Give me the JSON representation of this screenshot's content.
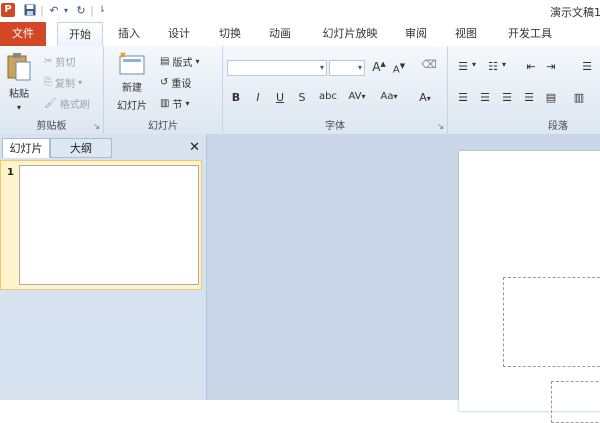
{
  "window": {
    "app_icon": "P",
    "title": "演示文稿1"
  },
  "quick_access": {
    "save_icon": "save-icon",
    "undo_icon": "undo-icon",
    "redo_icon": "redo-icon",
    "customize_icon": "customize-icon"
  },
  "tabs": [
    {
      "label": "文件"
    },
    {
      "label": "开始"
    },
    {
      "label": "插入"
    },
    {
      "label": "设计"
    },
    {
      "label": "切换"
    },
    {
      "label": "动画"
    },
    {
      "label": "幻灯片放映"
    },
    {
      "label": "审阅"
    },
    {
      "label": "视图"
    },
    {
      "label": "开发工具"
    }
  ],
  "ribbon": {
    "clipboard": {
      "label": "剪贴板",
      "paste": "粘贴",
      "cut": "剪切",
      "copy": "复制",
      "format_painter": "格式刷"
    },
    "slides": {
      "label": "幻灯片",
      "new_slide_line1": "新建",
      "new_slide_line2": "幻灯片",
      "layout": "版式",
      "reset": "重设",
      "section": "节"
    },
    "font": {
      "label": "字体",
      "font_name": "",
      "font_size": "",
      "bold": "B",
      "italic": "I",
      "underline": "U",
      "strike": "S",
      "shadow": "abc",
      "spacing": "AV",
      "case": "Aa",
      "color": "A"
    },
    "paragraph": {
      "label": "段落"
    }
  },
  "panel": {
    "tabs": [
      {
        "label": "幻灯片"
      },
      {
        "label": "大纲"
      }
    ],
    "close": "✕",
    "slide_number": "1"
  }
}
